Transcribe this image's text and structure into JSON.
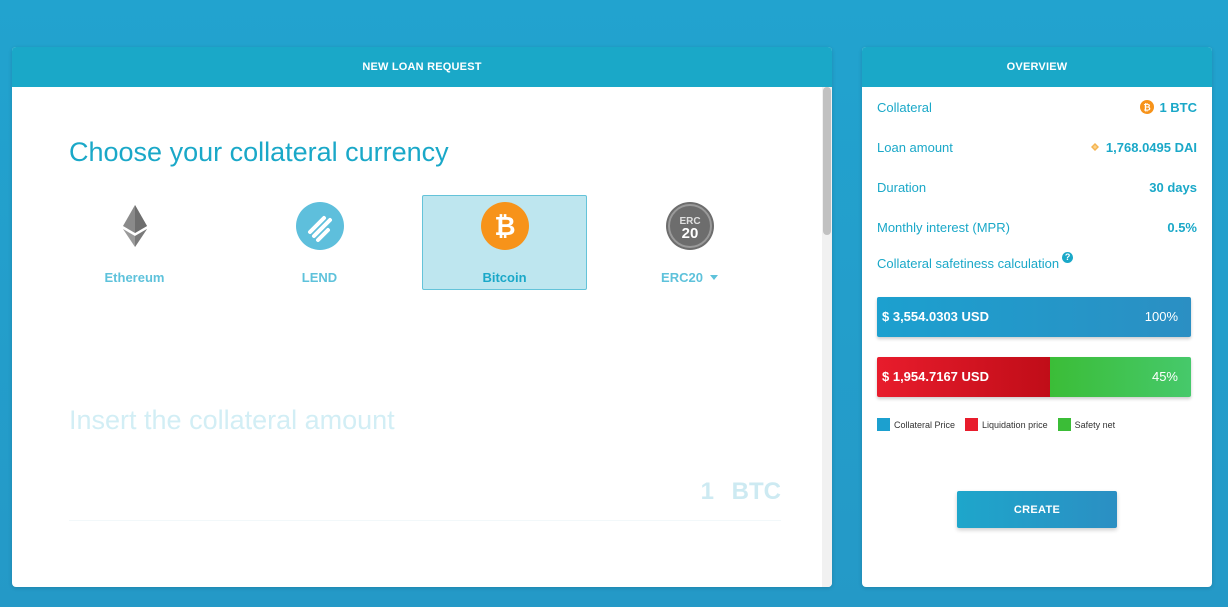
{
  "loan_panel": {
    "header": "NEW LOAN REQUEST",
    "choose_title": "Choose your collateral currency",
    "currencies": [
      {
        "label": "Ethereum",
        "icon": "ethereum-icon"
      },
      {
        "label": "LEND",
        "icon": "lend-icon"
      },
      {
        "label": "Bitcoin",
        "icon": "bitcoin-icon",
        "selected": true
      },
      {
        "label": "ERC20",
        "icon": "erc20-icon",
        "dropdown": true
      }
    ],
    "erc20_icon_text_top": "ERC",
    "erc20_icon_text_bottom": "20",
    "insert_title": "Insert the collateral amount",
    "amount_value": "1",
    "amount_unit": "BTC"
  },
  "overview": {
    "header": "OVERVIEW",
    "rows": [
      {
        "label": "Collateral",
        "value": "1 BTC",
        "icon": "bitcoin-icon"
      },
      {
        "label": "Loan amount",
        "value": "1,768.0495 DAI",
        "icon": "dai-icon"
      },
      {
        "label": "Duration",
        "value": "30 days"
      },
      {
        "label": "Monthly interest (MPR)",
        "value": "0.5%"
      }
    ],
    "safety_label": "Collateral safetiness calculation",
    "help_glyph": "?",
    "collateral_bar": {
      "amount": "$ 3,554.0303 USD",
      "percent_label": "100%",
      "percent": 100
    },
    "liquidation_bar": {
      "amount": "$ 1,954.7167 USD",
      "safety_percent_label": "45%",
      "liquidation_percent": 55,
      "safety_percent": 45
    },
    "legend": [
      {
        "label": "Collateral Price",
        "color": "#1ca0cf"
      },
      {
        "label": "Liquidation price",
        "color": "#e81c2c"
      },
      {
        "label": "Safety net",
        "color": "#3bbd37"
      }
    ],
    "create_label": "CREATE"
  },
  "colors": {
    "accent": "#1aa8c8",
    "bitcoin": "#f7931a",
    "lend": "#5ebfdc",
    "selected_bg": "#bee6ef"
  }
}
